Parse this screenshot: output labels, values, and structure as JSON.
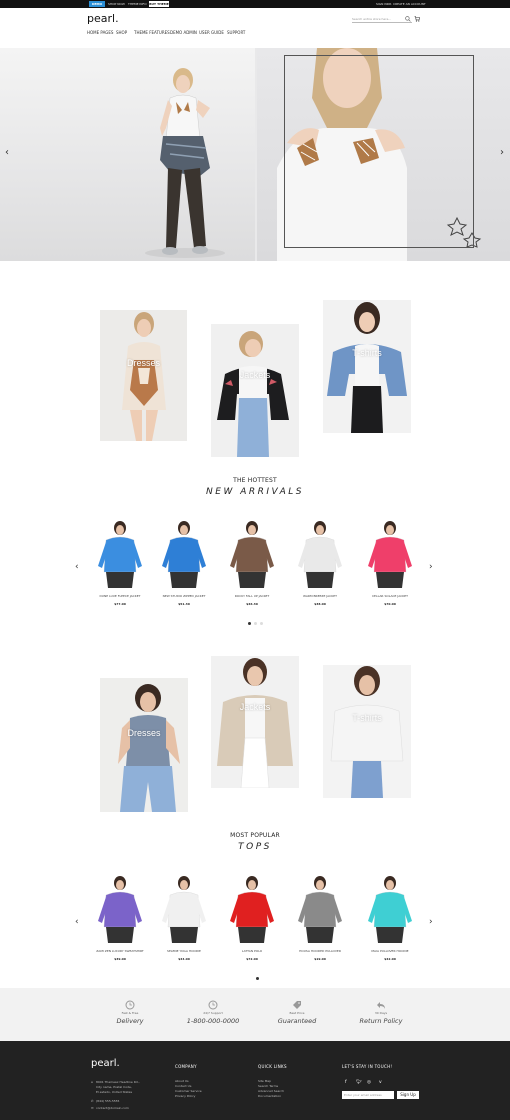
{
  "topbar": {
    "demo_label": "DEMO",
    "links": [
      "SHOP NOW",
      "THEME INFO"
    ],
    "theme_badge": "BUY THEME",
    "account_links": [
      "SIGN IN",
      "OR",
      "CREATE AN ACCOUNT"
    ]
  },
  "header": {
    "logo": "pearl.",
    "search_placeholder": "Search entire store here...",
    "nav": [
      "HOME PAGES",
      "SHOP",
      "THEME FEATURES",
      "DEMO ADMIN",
      "USER GUIDE",
      "SUPPORT"
    ]
  },
  "categories_1": [
    {
      "label": "Dresses"
    },
    {
      "label": "Jackets"
    },
    {
      "label": "T-shirts"
    }
  ],
  "section_new": {
    "sub": "THE HOTTEST",
    "title": "NEW ARRIVALS"
  },
  "products_new": [
    {
      "name": "DUNE LUXE FLEECE JACKET",
      "price": "$77.00",
      "color": "#3b8ee0"
    },
    {
      "name": "NEW STUDIO ZIPPED JACKET",
      "price": "$51.30",
      "color": "#2e7fd6"
    },
    {
      "name": "ROCKY FALL UP JACKET",
      "price": "$46.30",
      "color": "#7a5a48"
    },
    {
      "name": "WARM BREEZE JACKET",
      "price": "$38.00",
      "color": "#e9e9e9"
    },
    {
      "name": "CELLAR SOLACE JACKET",
      "price": "$70.00",
      "color": "#ef3f6a"
    }
  ],
  "categories_2": [
    {
      "label": "Dresses"
    },
    {
      "label": "Jackets"
    },
    {
      "label": "T-shirts"
    }
  ],
  "section_popular": {
    "sub": "MOST POPULAR",
    "title": "TOPS"
  },
  "products_popular": [
    {
      "name": "ZAMI ZEN LUXURY SWEATSHIRT",
      "price": "$39.00",
      "color": "#7b63c9"
    },
    {
      "name": "SELENE YOGA HOODIE",
      "price": "$44.00",
      "color": "#f0f0f0"
    },
    {
      "name": "LATTAN POLO",
      "price": "$72.00",
      "color": "#e02020"
    },
    {
      "name": "HOUSA HOODED PULLOVER",
      "price": "$19.00",
      "color": "#8a8a8a"
    },
    {
      "name": "MAIA PULLOVER HOODIE",
      "price": "$42.00",
      "color": "#3fcfd3"
    }
  ],
  "features": [
    {
      "sub": "Fast & Free",
      "main": "Delivery",
      "icon": "clock-icon"
    },
    {
      "sub": "24/7 Support",
      "main": "1-800-000-0000",
      "icon": "clock-icon"
    },
    {
      "sub": "Best Price",
      "main": "Guaranteed",
      "icon": "tag-icon"
    },
    {
      "sub": "30 Days",
      "main": "Return Policy",
      "icon": "return-icon"
    }
  ],
  "footer": {
    "logo": "pearl.",
    "address": [
      "8901 Themeax Headline Rd.,",
      "City name, Postal Code,",
      "El estado, United States"
    ],
    "phone": "(844) 555-5555",
    "email": "contact@domain.com",
    "company_head": "COMPANY",
    "company_links": [
      "About Us",
      "Contact Us",
      "Customer Service",
      "Privacy Policy"
    ],
    "quick_head": "QUICK LINKS",
    "quick_links": [
      "Site Map",
      "Search Terms",
      "Advanced Search",
      "Documentation"
    ],
    "newsletter_head": "LET'S STAY IN TOUCH!",
    "newsletter_placeholder": "Enter your email address",
    "newsletter_button": "Sign Up"
  }
}
